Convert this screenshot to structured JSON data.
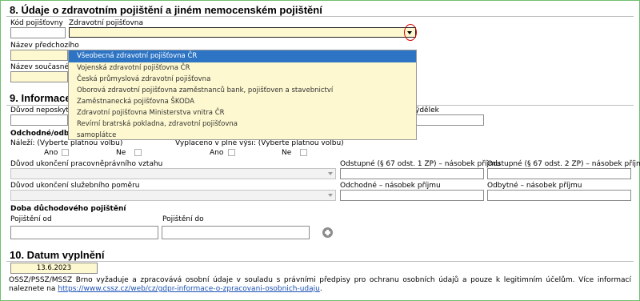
{
  "section8": {
    "title": "8. Údaje o zdravotním pojištění a jiném nemocenském pojištění",
    "insurer_code_label": "Kód pojišťovny",
    "insurer_label": "Zdravotní pojišťovna",
    "prev_name_label": "Název předchozího",
    "curr_name_label": "Název současného",
    "insurer_options": [
      "Všeobecná zdravotní pojišťovna ČR",
      "Vojenská zdravotní pojišťovna ČR",
      "Česká průmyslová zdravotní pojišťovna",
      "Oborová zdravotní pojišťovna zaměstnanců bank, pojišťoven a stavebnictví",
      "Zaměstnanecká pojišťovna ŠKODA",
      "Zdravotní pojišťovna Ministerstva vnitra ČR",
      "Revírní bratrská pokladna, zdravotní pojišťovna",
      "samoplátce"
    ],
    "selected_option": "Všeobecná zdravotní pojišťovna ČR"
  },
  "section9": {
    "title": "9. Informace p",
    "reason_nonpaid_label": "Důvod neposkytnut",
    "earnings_label": "ýdělek",
    "severance_label": "Odchodné/odbyt",
    "entitled_label": "Náleží: (Vyberte platnou volbu)",
    "paid_full_label": "Vyplaceno v plné výši: (Vyberte platnou volbu)",
    "yes": "Ano",
    "no": "Ne",
    "end_employment_label": "Důvod ukončení pracovněprávního vztahu",
    "end_service_label": "Důvod ukončení služebního poměru",
    "odstupne1_label": "Odstupné (§ 67 odst. 1 ZP) – násobek příjmu",
    "odstupne2_label": "Odstupné (§ 67 odst. 2 ZP) – násobek příjmu",
    "odchodne_label": "Odchodné – násobek příjmu",
    "odbytne_label": "Odbytné – násobek příjmu",
    "pension_title": "Doba důchodového pojištění",
    "insurance_from_label": "Pojištění od",
    "insurance_to_label": "Pojištění do"
  },
  "section10": {
    "title": "10. Datum vyplnění",
    "date_value": "13.6.2023"
  },
  "footer": {
    "text": "OSSZ/PSSZ/MSSZ Brno vyžaduje a zpracovává osobní údaje v souladu s právními předpisy pro ochranu osobních údajů a pouze k legitimním účelům. Více informací naleznete na",
    "link": "https://www.cssz.cz/web/cz/gdpr-informace-o-zpracovani-osobnich-udaju",
    "link_suffix": "."
  }
}
